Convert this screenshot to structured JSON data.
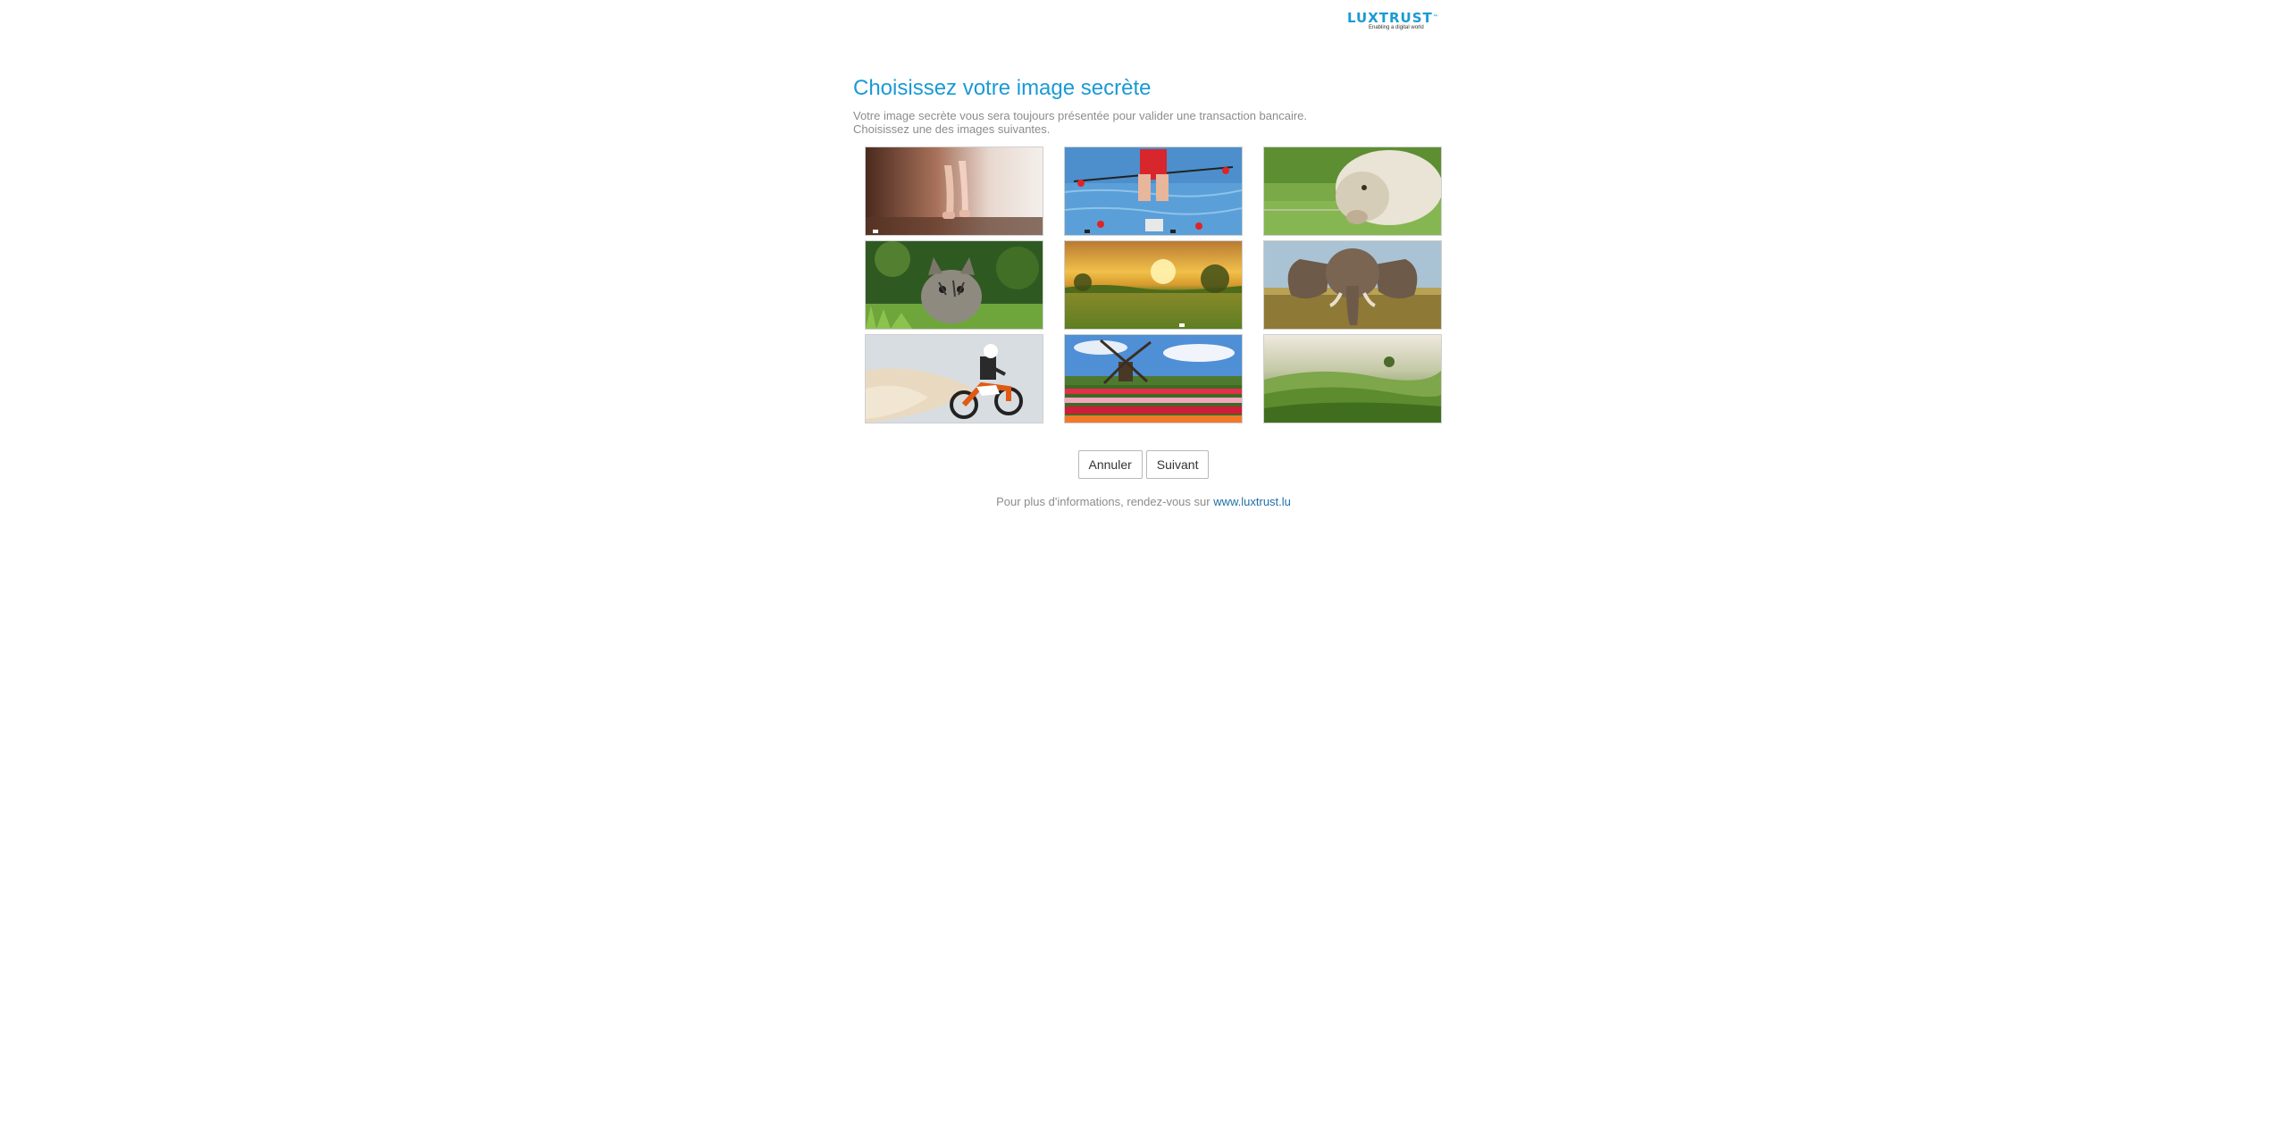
{
  "brand": {
    "name": "LUXTRUST",
    "tagline": "Enabling a digital world",
    "color": "#1a9ad6"
  },
  "heading": "Choisissez votre image secrète",
  "description": {
    "line1": "Votre image secrète vous sera toujours présentée pour valider une transaction bancaire.",
    "line2": "Choisissez une des images suivantes."
  },
  "images": [
    {
      "subject": "ballet-dancer-feet"
    },
    {
      "subject": "rowing-athlete"
    },
    {
      "subject": "sheep"
    },
    {
      "subject": "kitten-in-grass"
    },
    {
      "subject": "sunset-field"
    },
    {
      "subject": "elephant"
    },
    {
      "subject": "motocross-rider"
    },
    {
      "subject": "windmill-tulips"
    },
    {
      "subject": "green-hills"
    }
  ],
  "buttons": {
    "cancel": "Annuler",
    "next": "Suivant"
  },
  "footer": {
    "text": "Pour plus d'informations, rendez-vous sur",
    "link_text": "www.luxtrust.lu"
  }
}
